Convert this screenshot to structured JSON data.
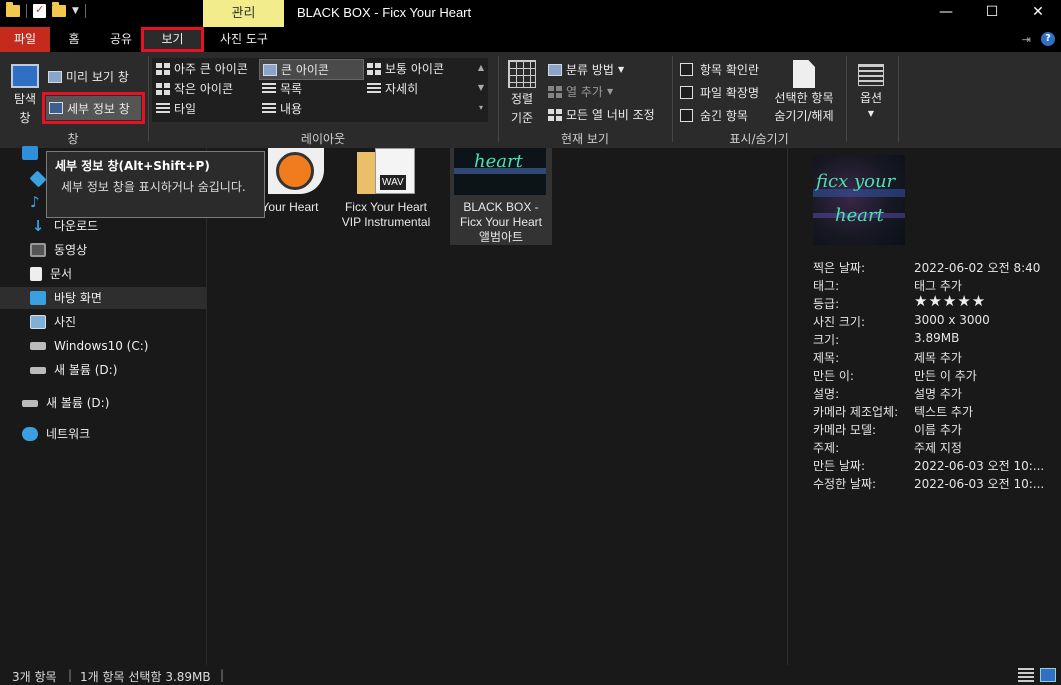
{
  "window": {
    "title": "BLACK BOX - Ficx Your Heart",
    "context_tab": "관리",
    "buttons": {
      "minimize": "—",
      "maximize": "☐",
      "close": "✕"
    }
  },
  "tabs": {
    "file": "파일",
    "home": "홈",
    "share": "공유",
    "view": "보기",
    "picture_tools": "사진 도구"
  },
  "ribbon": {
    "pane": {
      "nav_pane_l1": "탐색",
      "nav_pane_l2": "창",
      "preview_pane": "미리 보기 창",
      "details_pane": "세부 정보 창",
      "group_label": "창"
    },
    "layout": {
      "extra_large": "아주 큰 아이콘",
      "large": "큰 아이콘",
      "medium": "보통 아이콘",
      "small": "작은 아이콘",
      "list": "목록",
      "details": "자세히",
      "tiles": "타일",
      "content": "내용",
      "group_label": "레이아웃"
    },
    "current_view": {
      "sort_l1": "정렬",
      "sort_l2": "기준",
      "group_by": "분류 방법",
      "add_columns": "열 추가",
      "size_all_columns": "모든 열 너비 조정",
      "group_label": "현재 보기"
    },
    "show_hide": {
      "item_checkboxes": "항목 확인란",
      "file_extensions": "파일 확장명",
      "hidden_items": "숨긴 항목",
      "hide_selected_l1": "선택한 항목",
      "hide_selected_l2": "숨기기/해제",
      "group_label": "표시/숨기기"
    },
    "options": {
      "label": "옵션"
    }
  },
  "tooltip": {
    "title": "세부 정보 창(Alt+Shift+P)",
    "body": "세부 정보 창을 표시하거나 숨깁니다."
  },
  "nav": {
    "downloads": "다운로드",
    "videos": "동영상",
    "documents": "문서",
    "desktop": "바탕 화면",
    "pictures": "사진",
    "drive_c": "Windows10 (C:)",
    "drive_d": "새 볼륨 (D:)",
    "drive_d2": "새 볼륨 (D:)",
    "network": "네트워크"
  },
  "files": [
    {
      "name_l1": "Your Heart",
      "name_l2": ""
    },
    {
      "name_l1": "Ficx Your Heart",
      "name_l2": "VIP Instrumental",
      "badge": "WAV"
    },
    {
      "name_l1": "BLACK BOX -",
      "name_l2": "Ficx Your Heart",
      "name_l3": "앨범아트"
    }
  ],
  "details": {
    "thumb_text_1": "ficx your",
    "thumb_text_2": "heart",
    "props": [
      {
        "label": "찍은 날짜:",
        "value": "2022-06-02 오전 8:40"
      },
      {
        "label": "태그:",
        "value": "태그 추가"
      },
      {
        "label": "등급:",
        "value": "★★★★★"
      },
      {
        "label": "사진 크기:",
        "value": "3000 x 3000"
      },
      {
        "label": "크기:",
        "value": "3.89MB"
      },
      {
        "label": "제목:",
        "value": "제목 추가"
      },
      {
        "label": "만든 이:",
        "value": "만든 이 추가"
      },
      {
        "label": "설명:",
        "value": "설명 추가"
      },
      {
        "label": "카메라 제조업체:",
        "value": "텍스트 추가"
      },
      {
        "label": "카메라 모델:",
        "value": "이름 추가"
      },
      {
        "label": "주제:",
        "value": "주제 지정"
      },
      {
        "label": "만든 날짜:",
        "value": "2022-06-03 오전 10:..."
      },
      {
        "label": "수정한 날짜:",
        "value": "2022-06-03 오전 10:..."
      }
    ]
  },
  "status": {
    "item_count": "3개 항목",
    "selection": "1개 항목 선택함 3.89MB"
  }
}
